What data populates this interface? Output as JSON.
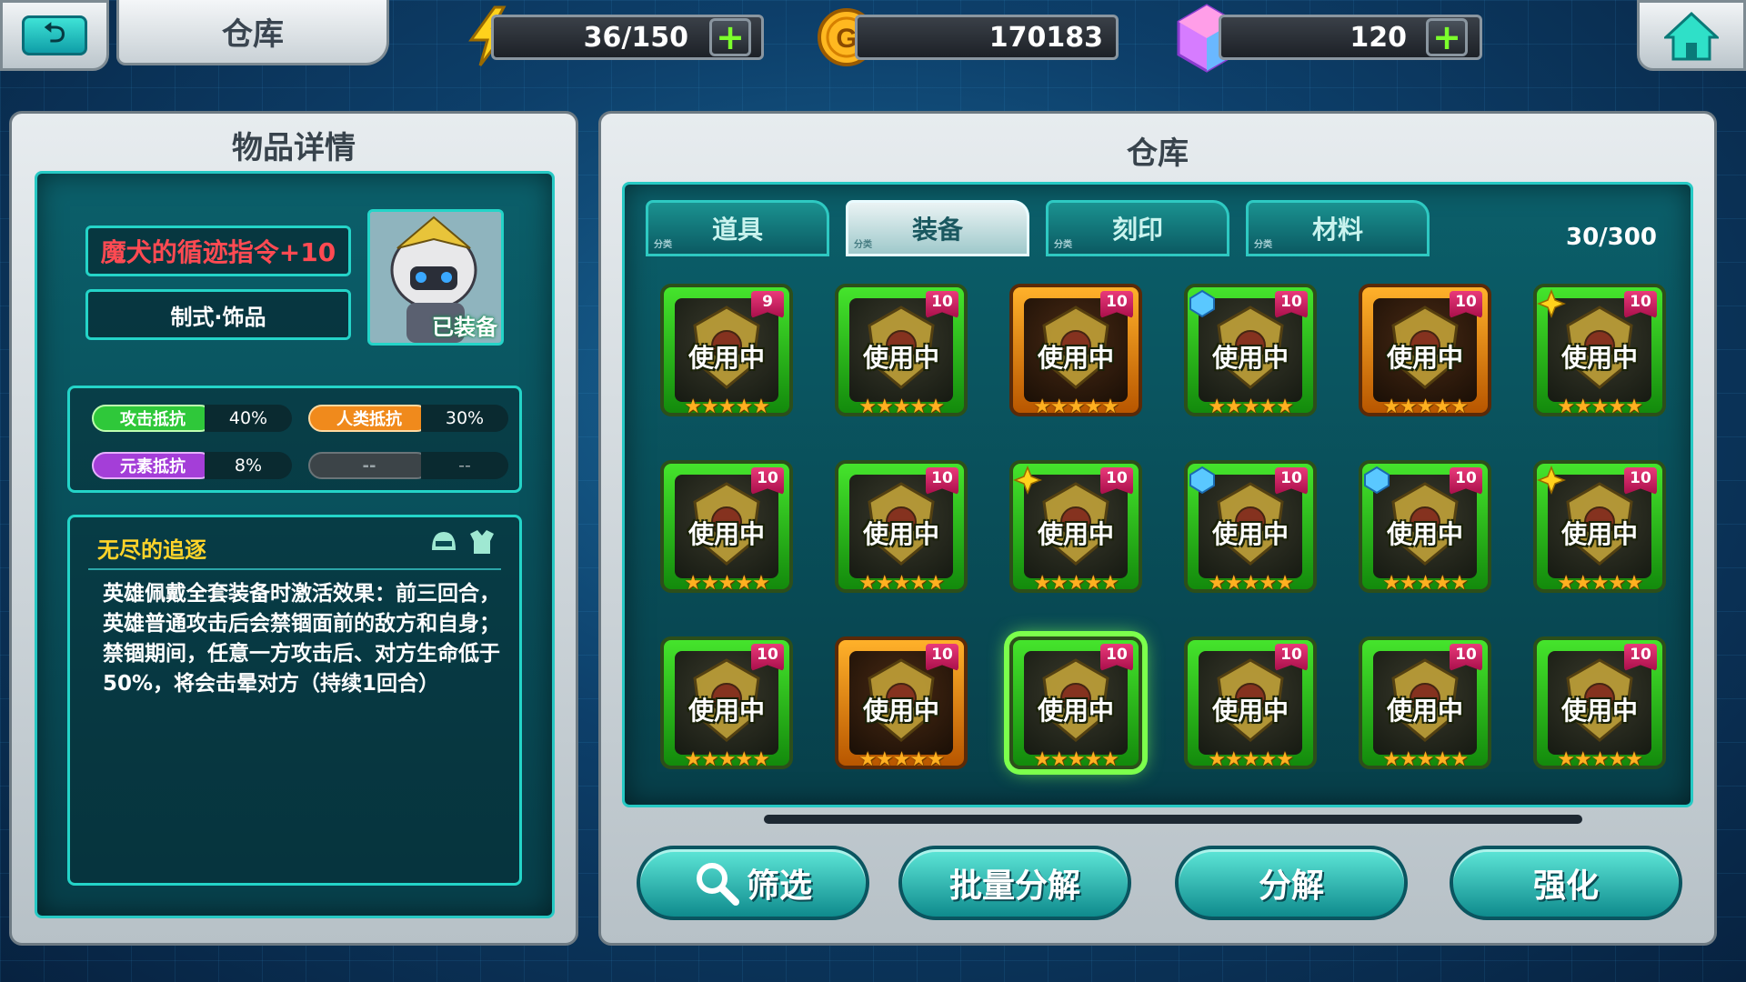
{
  "header": {
    "title": "仓库",
    "energy": "36/150",
    "gold": "170183",
    "gems": "120"
  },
  "detail": {
    "title": "物品详情",
    "item_name": "魔犬的循迹指令+10",
    "item_type": "制式·饰品",
    "equipped_label": "已装备",
    "stats": [
      {
        "label": "攻击抵抗",
        "value": "40%",
        "color": "#2fc83a"
      },
      {
        "label": "人类抵抗",
        "value": "30%",
        "color": "#f08a1c"
      },
      {
        "label": "元素抵抗",
        "value": "8%",
        "color": "#a43ed8"
      },
      {
        "label": "--",
        "value": "--",
        "color": "#3c4448"
      }
    ],
    "set_name": "无尽的追逐",
    "set_desc": "英雄佩戴全套装备时激活效果：前三回合，英雄普通攻击后会禁锢面前的敌方和自身；禁锢期间，任意一方攻击后、对方生命低于50%，将会击晕对方（持续1回合）"
  },
  "warehouse": {
    "title": "仓库",
    "tabs": [
      {
        "label": "道具",
        "corner": "分类",
        "active": false
      },
      {
        "label": "装备",
        "corner": "分类",
        "active": true
      },
      {
        "label": "刻印",
        "corner": "分类",
        "active": false
      },
      {
        "label": "材料",
        "corner": "分类",
        "active": false
      }
    ],
    "count": "30/300",
    "items": [
      {
        "level": "9",
        "status": "使用中",
        "stars": "★★★★★",
        "frame": "green",
        "gem": ""
      },
      {
        "level": "10",
        "status": "使用中",
        "stars": "★★★★★",
        "frame": "green",
        "gem": ""
      },
      {
        "level": "10",
        "status": "使用中",
        "stars": "★★★★★",
        "frame": "orange",
        "gem": ""
      },
      {
        "level": "10",
        "status": "使用中",
        "stars": "★★★★★",
        "frame": "green",
        "gem": "blue"
      },
      {
        "level": "10",
        "status": "使用中",
        "stars": "★★★★★",
        "frame": "orange",
        "gem": ""
      },
      {
        "level": "10",
        "status": "使用中",
        "stars": "★★★★★",
        "frame": "green",
        "gem": "gold"
      },
      {
        "level": "10",
        "status": "使用中",
        "stars": "★★★★★",
        "frame": "green",
        "gem": ""
      },
      {
        "level": "10",
        "status": "使用中",
        "stars": "★★★★★",
        "frame": "green",
        "gem": ""
      },
      {
        "level": "10",
        "status": "使用中",
        "stars": "★★★★★",
        "frame": "green",
        "gem": "gold"
      },
      {
        "level": "10",
        "status": "使用中",
        "stars": "★★★★★",
        "frame": "green",
        "gem": "blue"
      },
      {
        "level": "10",
        "status": "使用中",
        "stars": "★★★★★",
        "frame": "green",
        "gem": "blue"
      },
      {
        "level": "10",
        "status": "使用中",
        "stars": "★★★★★",
        "frame": "green",
        "gem": "gold"
      },
      {
        "level": "10",
        "status": "使用中",
        "stars": "★★★★★",
        "frame": "green",
        "gem": ""
      },
      {
        "level": "10",
        "status": "使用中",
        "stars": "★★★★★",
        "frame": "orange",
        "gem": ""
      },
      {
        "level": "10",
        "status": "使用中",
        "stars": "★★★★★",
        "frame": "green",
        "gem": "",
        "selected": true
      },
      {
        "level": "10",
        "status": "使用中",
        "stars": "★★★★★",
        "frame": "green",
        "gem": ""
      },
      {
        "level": "10",
        "status": "使用中",
        "stars": "★★★★★",
        "frame": "green",
        "gem": ""
      },
      {
        "level": "10",
        "status": "使用中",
        "stars": "★★★★★",
        "frame": "green",
        "gem": ""
      }
    ],
    "buttons": {
      "filter": "筛选",
      "batch": "批量分解",
      "decompose": "分解",
      "enhance": "强化"
    }
  }
}
